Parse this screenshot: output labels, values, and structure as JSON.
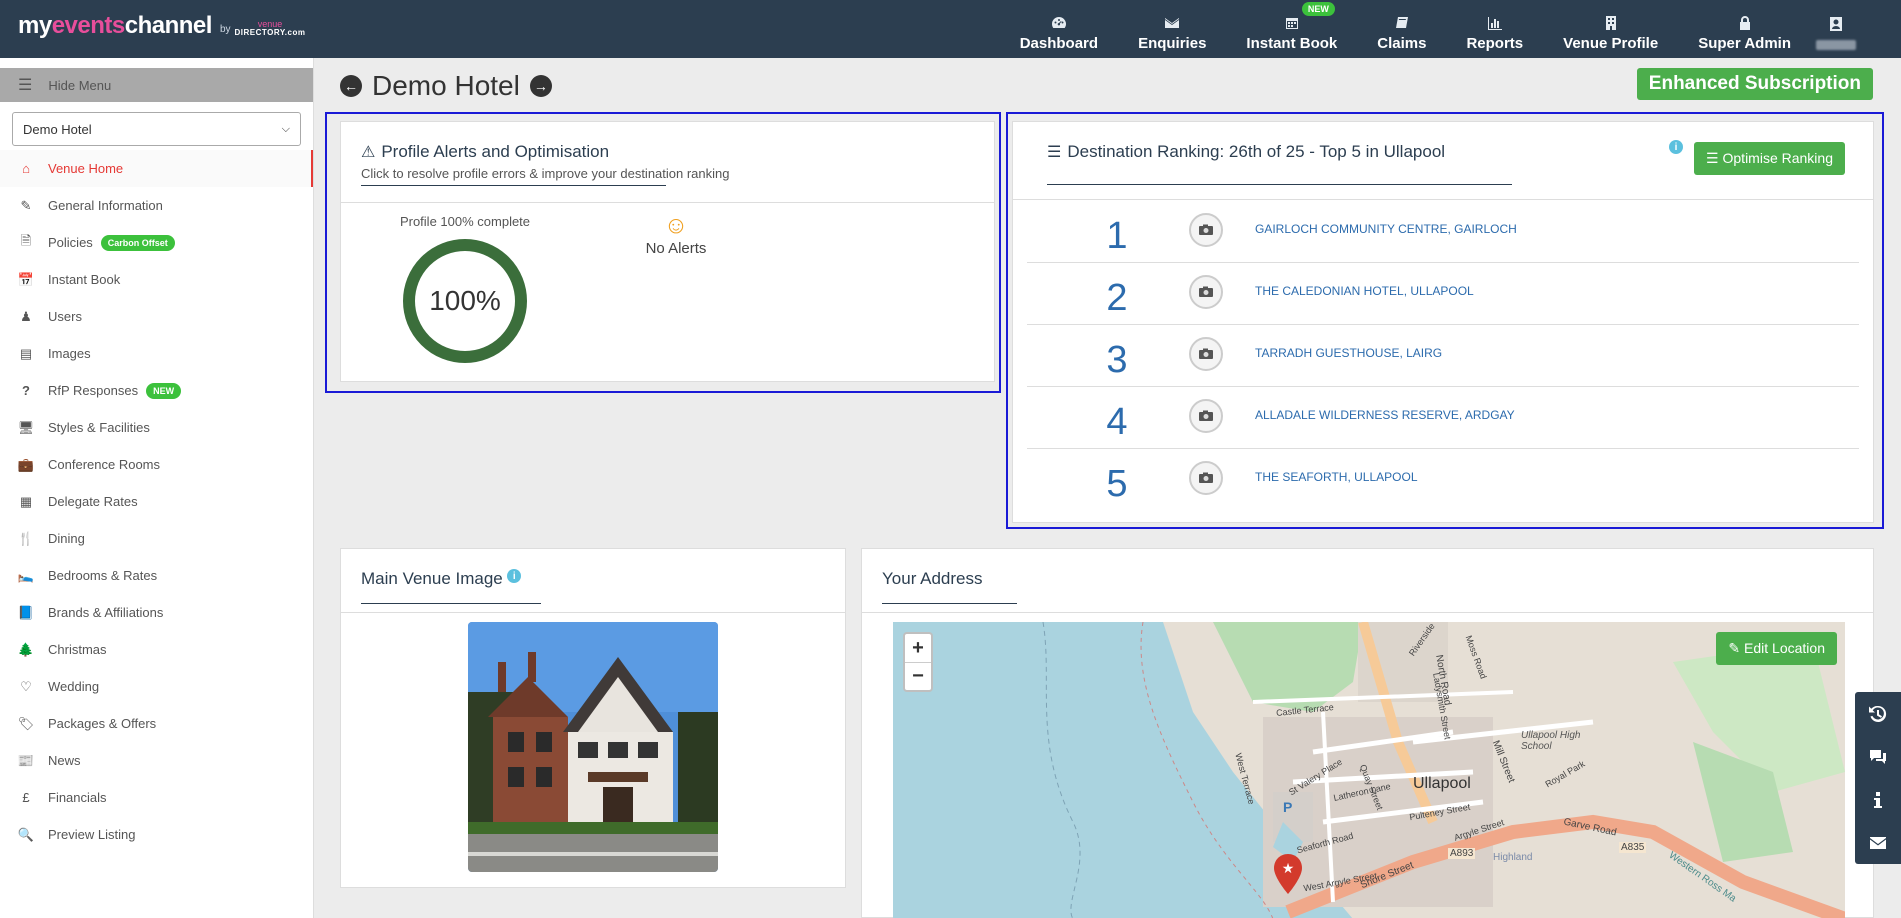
{
  "brand": {
    "logo_main_1": "my",
    "logo_main_2": "events",
    "logo_main_3": "channel",
    "logo_by": "by",
    "logo_venue": "venue",
    "logo_directory": "DIRECTORY.com"
  },
  "nav": {
    "items": [
      {
        "label": "Dashboard",
        "icon": "dashboard-icon"
      },
      {
        "label": "Enquiries",
        "icon": "envelope-icon"
      },
      {
        "label": "Instant Book",
        "icon": "calendar-icon",
        "badge": "NEW"
      },
      {
        "label": "Claims",
        "icon": "book-icon"
      },
      {
        "label": "Reports",
        "icon": "bar-chart-icon"
      },
      {
        "label": "Venue Profile",
        "icon": "building-icon"
      },
      {
        "label": "Super Admin",
        "icon": "lock-icon"
      }
    ]
  },
  "sidebar": {
    "hide_menu": "Hide Menu",
    "venue_select": "Demo Hotel",
    "items": [
      {
        "label": "Venue Home",
        "icon": "home-icon",
        "active": true
      },
      {
        "label": "General Information",
        "icon": "edit-icon"
      },
      {
        "label": "Policies",
        "icon": "document-icon",
        "badge": "Carbon Offset"
      },
      {
        "label": "Instant Book",
        "icon": "calendar-icon"
      },
      {
        "label": "Users",
        "icon": "user-icon"
      },
      {
        "label": "Images",
        "icon": "image-icon"
      },
      {
        "label": "RfP Responses",
        "icon": "question-icon",
        "badge": "NEW"
      },
      {
        "label": "Styles & Facilities",
        "icon": "monitor-icon"
      },
      {
        "label": "Conference Rooms",
        "icon": "briefcase-icon"
      },
      {
        "label": "Delegate Rates",
        "icon": "calculator-icon"
      },
      {
        "label": "Dining",
        "icon": "cutlery-icon"
      },
      {
        "label": "Bedrooms & Rates",
        "icon": "bed-icon"
      },
      {
        "label": "Brands & Affiliations",
        "icon": "book-icon"
      },
      {
        "label": "Christmas",
        "icon": "tree-icon"
      },
      {
        "label": "Wedding",
        "icon": "heart-icon"
      },
      {
        "label": "Packages & Offers",
        "icon": "tags-icon"
      },
      {
        "label": "News",
        "icon": "newspaper-icon"
      },
      {
        "label": "Financials",
        "icon": "pound-icon"
      },
      {
        "label": "Preview Listing",
        "icon": "search-icon"
      }
    ]
  },
  "page": {
    "title": "Demo Hotel",
    "subscription": "Enhanced Subscription"
  },
  "alerts": {
    "title": "Profile Alerts and Optimisation",
    "subtitle": "Click to resolve profile errors & improve your destination ranking",
    "progress_label": "Profile 100% complete",
    "progress_value": "100%",
    "progress_fraction": 1.0,
    "no_alerts": "No Alerts"
  },
  "ranking": {
    "title": "Destination Ranking: 26th of 25 - Top 5 in Ullapool",
    "button": "Optimise Ranking",
    "rows": [
      {
        "rank": "1",
        "name": "GAIRLOCH COMMUNITY CENTRE, GAIRLOCH"
      },
      {
        "rank": "2",
        "name": "THE CALEDONIAN HOTEL, ULLAPOOL"
      },
      {
        "rank": "3",
        "name": "TARRADH GUESTHOUSE, LAIRG"
      },
      {
        "rank": "4",
        "name": "ALLADALE WILDERNESS RESERVE, ARDGAY"
      },
      {
        "rank": "5",
        "name": "THE SEAFORTH, ULLAPOOL"
      }
    ]
  },
  "main_image": {
    "title": "Main Venue Image"
  },
  "address": {
    "title": "Your Address",
    "edit_button": "Edit Location",
    "zoom_in": "+",
    "zoom_out": "−",
    "map_labels": [
      "Ullapool",
      "North Road",
      "Mill Street",
      "Garve Road",
      "A835",
      "A893",
      "Shore Street",
      "Argyle Street",
      "Quay Street",
      "Pulteney Street",
      "Seaforth Road",
      "Castle Terrace",
      "Ladysmith Street",
      "Royal Park",
      "Ullapool High School",
      "Moss Road",
      "Riverside Terrace",
      "St Valery Place",
      "Latheron Lane",
      "West Argyle Street",
      "West Terrace",
      "Highland",
      "Western Ross Ma",
      "P"
    ]
  },
  "tools": [
    "history-icon",
    "chat-icon",
    "info-icon",
    "mail-icon"
  ],
  "colors": {
    "nav_bg": "#2c3e50",
    "accent_green": "#4cae4c",
    "active_red": "#e53935",
    "link_blue": "#2c6bad",
    "highlight_border": "#1a1ad6"
  }
}
